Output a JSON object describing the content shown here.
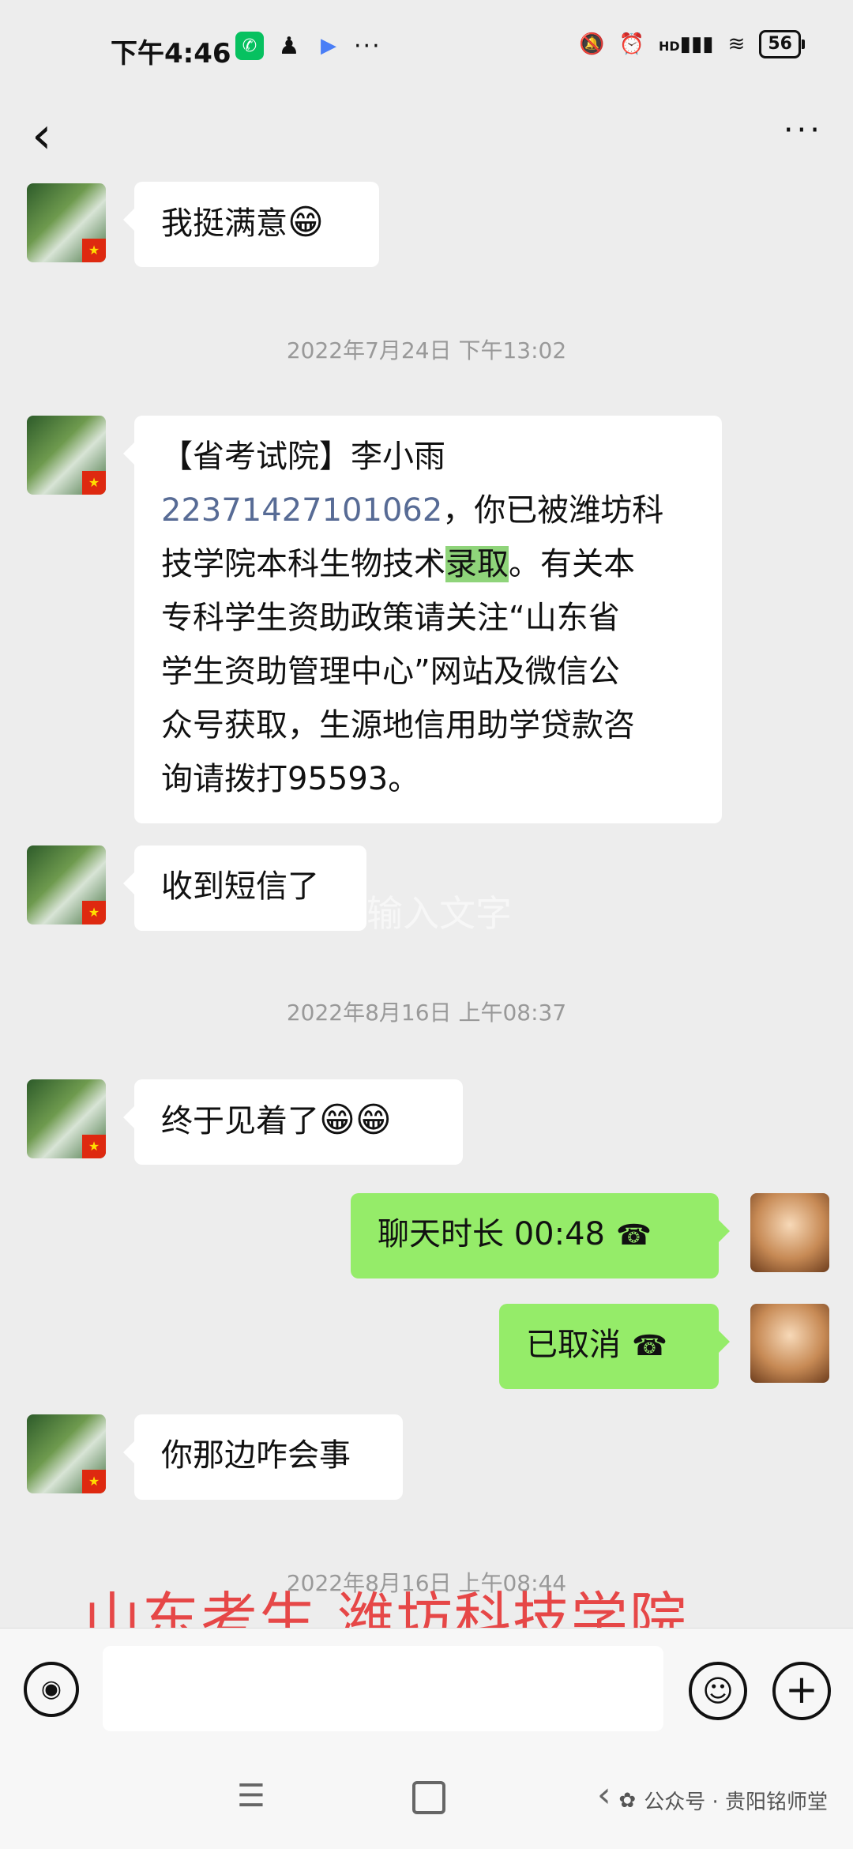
{
  "status_bar": {
    "time": "下午4:46",
    "battery": "56",
    "network": "HD",
    "more": "···"
  },
  "nav": {
    "back_icon": "chevron-left-icon",
    "more": "···"
  },
  "messages": [
    {
      "side": "left",
      "text": "我挺满意",
      "emoji": "😁"
    },
    {
      "type": "timestamp",
      "text": "2022年7月24日 下午13:02"
    },
    {
      "side": "left",
      "line1": "【省考试院】李小雨",
      "number": "22371427101062",
      "line2a": "，你已被潍坊科",
      "line3a": "技学院本科生物技术",
      "highlight": "录取",
      "line3b": "。有关本",
      "line4": "专科学生资助政策请关注“山东省",
      "line5": "学生资助管理中心”网站及微信公",
      "line6": "众号获取，生源地信用助学贷款咨",
      "line7": "询请拨打95593。"
    },
    {
      "side": "left",
      "text": "收到短信了"
    },
    {
      "type": "timestamp",
      "text": "2022年8月16日 上午08:37"
    },
    {
      "side": "left",
      "text": "终于见着了",
      "emoji": "😁😁"
    },
    {
      "side": "right",
      "text": "聊天时长 00:48"
    },
    {
      "side": "right",
      "text": "已取消"
    },
    {
      "side": "left",
      "text": "你那边咋会事"
    },
    {
      "type": "timestamp",
      "text": "2022年8月16日 上午08:44"
    }
  ],
  "watermark_mid": "点击输入文字",
  "overlay_caption": "山东考生 潍坊科技学院",
  "input_bar": {
    "voice_icon": "voice-icon",
    "emoji_icon": "emoji-icon",
    "plus_icon": "plus-icon"
  },
  "system_nav": {
    "watermark": "公众号 · 贵阳铭师堂"
  }
}
